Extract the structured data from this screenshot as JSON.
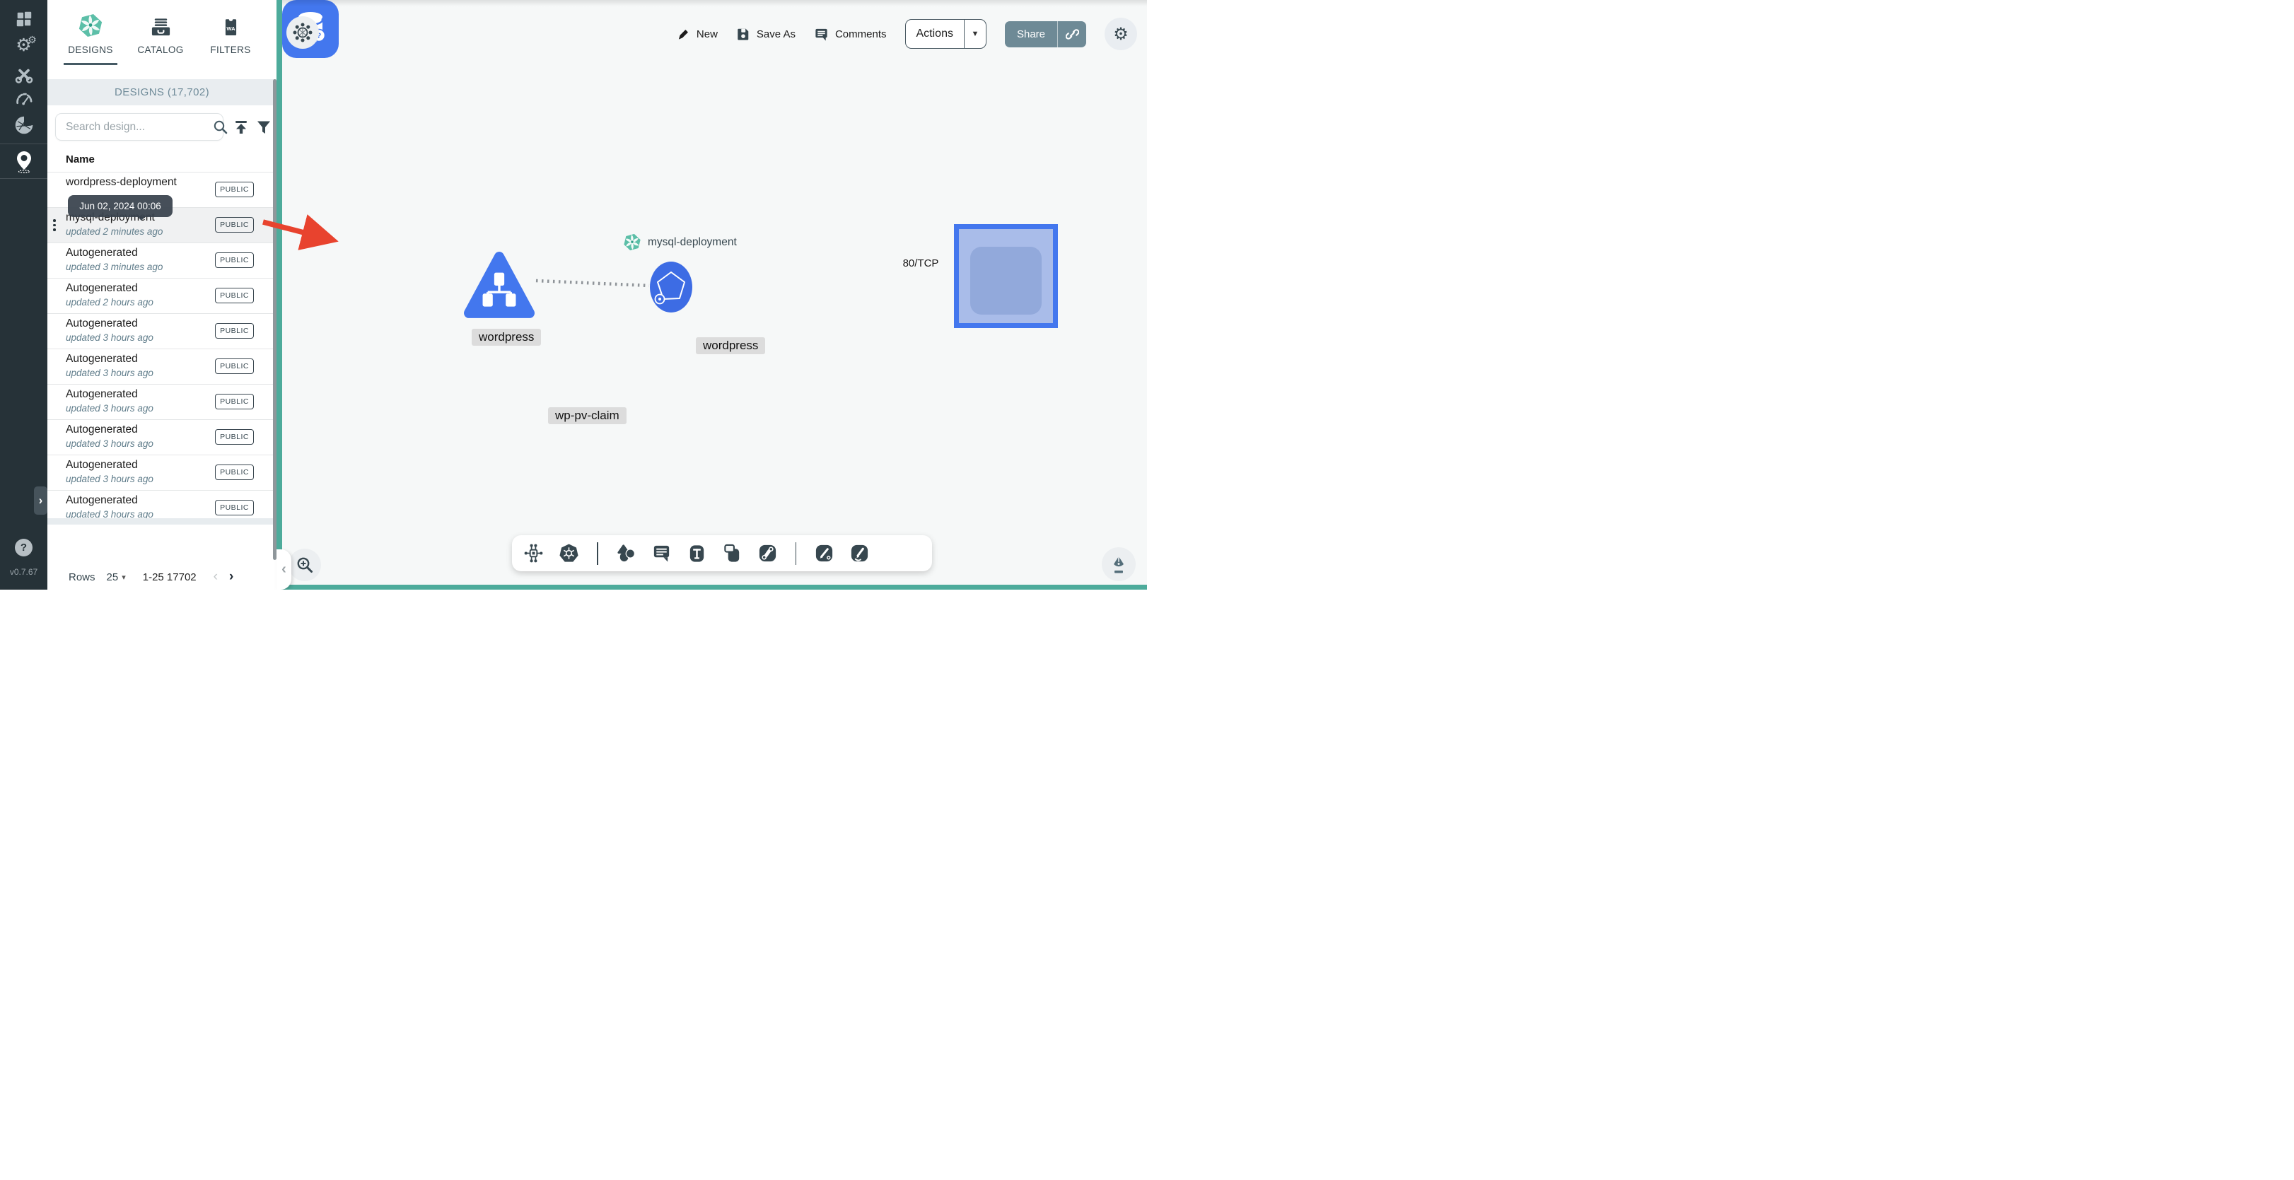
{
  "colors": {
    "sidebar_dark": "#263238",
    "accent_teal": "#4DAB9B",
    "node_blue": "#4377EE",
    "selection_fill": "#A9BCE9",
    "share_button": "#6E8A96"
  },
  "sidebar": {
    "items": [
      "dashboard",
      "lifecycle",
      "configuration",
      "performance",
      "extensions",
      "kanvas"
    ],
    "expand_glyph": "›",
    "help_label": "?",
    "version": "v0.7.67"
  },
  "panel": {
    "tabs": [
      {
        "label": "DESIGNS",
        "active": true
      },
      {
        "label": "CATALOG",
        "active": false
      },
      {
        "label": "FILTERS",
        "badge": "WA",
        "active": false
      }
    ],
    "count_header": "DESIGNS (17,702)",
    "search_placeholder": "Search design...",
    "column_name": "Name",
    "tooltip": "Jun 02, 2024 00:06",
    "rows": [
      {
        "title": "wordpress-deployment",
        "subtitle": "",
        "badge": "PUBLIC",
        "highlighted": false
      },
      {
        "title": "mysql-deployment",
        "subtitle": "updated 2 minutes ago",
        "badge": "PUBLIC",
        "highlighted": true
      },
      {
        "title": "Autogenerated",
        "subtitle": "updated 3 minutes ago",
        "badge": "PUBLIC",
        "highlighted": false
      },
      {
        "title": "Autogenerated",
        "subtitle": "updated 2 hours ago",
        "badge": "PUBLIC",
        "highlighted": false
      },
      {
        "title": "Autogenerated",
        "subtitle": "updated 3 hours ago",
        "badge": "PUBLIC",
        "highlighted": false
      },
      {
        "title": "Autogenerated",
        "subtitle": "updated 3 hours ago",
        "badge": "PUBLIC",
        "highlighted": false
      },
      {
        "title": "Autogenerated",
        "subtitle": "updated 3 hours ago",
        "badge": "PUBLIC",
        "highlighted": false
      },
      {
        "title": "Autogenerated",
        "subtitle": "updated 3 hours ago",
        "badge": "PUBLIC",
        "highlighted": false
      },
      {
        "title": "Autogenerated",
        "subtitle": "updated 3 hours ago",
        "badge": "PUBLIC",
        "highlighted": false
      },
      {
        "title": "Autogenerated",
        "subtitle": "updated 3 hours ago",
        "badge": "PUBLIC",
        "highlighted": false
      }
    ],
    "footer": {
      "rows_label": "Rows",
      "page_size": "25",
      "caret": "▾",
      "range": "1-25 17702",
      "prev": "‹",
      "next": "›"
    }
  },
  "topbar": {
    "new_label": "New",
    "save_as_label": "Save As",
    "comments_label": "Comments",
    "actions_label": "Actions",
    "actions_caret": "▼",
    "share_label": "Share"
  },
  "canvas": {
    "design_label": "mysql-deployment",
    "edge_label": "80/TCP",
    "deployment_label": "wordpress",
    "container_label": "wordpress",
    "pvc_label": "wp-pv-claim"
  },
  "dock": {
    "tools": [
      "component-tool",
      "kubernetes-tool",
      "shapes-tool",
      "comment-tool",
      "text-tool",
      "rectangle-tool",
      "edge-tool",
      "pen-tool",
      "pencil-tool"
    ]
  }
}
